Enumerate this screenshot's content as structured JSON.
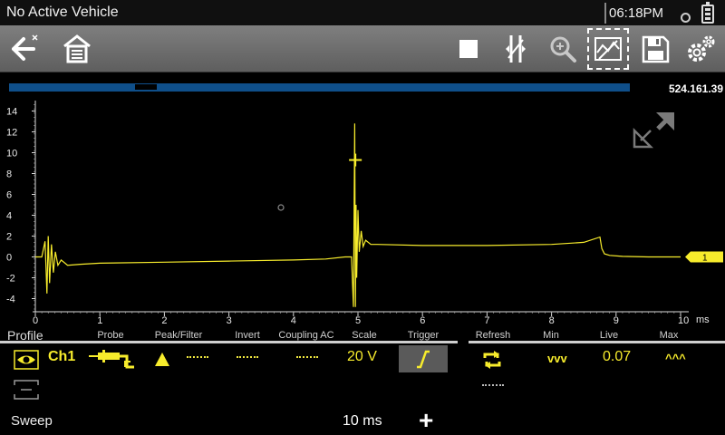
{
  "status": {
    "title": "No Active Vehicle",
    "clock": "06:18PM"
  },
  "toolbar": {
    "buttons": [
      "back-icon",
      "home-icon",
      "stop-icon",
      "cursor-icon",
      "zoom-icon",
      "capture-icon",
      "save-icon",
      "settings-icon"
    ]
  },
  "playback": {
    "position_readout": "524.161.39",
    "thumb_position_fraction": 0.22
  },
  "chart_data": {
    "type": "line",
    "xlabel": "ms",
    "ylabel": "",
    "xlim": [
      0,
      10
    ],
    "ylim": [
      -5,
      15
    ],
    "x_ticks": [
      "0",
      "1",
      "2",
      "3",
      "4",
      "5",
      "6",
      "7",
      "8",
      "9",
      "10"
    ],
    "y_ticks": [
      "14",
      "12",
      "10",
      "8",
      "6",
      "4",
      "2",
      "0",
      "-2",
      "-4"
    ],
    "series": [
      {
        "name": "Ch1",
        "color": "#f7ec2c",
        "x": [
          0,
          0.1,
          0.15,
          0.18,
          0.2,
          0.22,
          0.25,
          0.28,
          0.31,
          0.35,
          0.4,
          0.5,
          0.7,
          1,
          2,
          3,
          4,
          4.5,
          4.8,
          4.9,
          4.93,
          4.95,
          4.96,
          4.97,
          4.98,
          5,
          5.02,
          5.05,
          5.08,
          5.12,
          5.2,
          5.3,
          6,
          7,
          8,
          8.5,
          8.75,
          8.78,
          8.82,
          8.9,
          9.1,
          9.5,
          10
        ],
        "y": [
          0,
          0,
          1.5,
          -3.5,
          2,
          -2.5,
          1.2,
          -1.5,
          0.5,
          -0.8,
          -0.3,
          -0.8,
          -0.7,
          -0.6,
          -0.5,
          -0.4,
          -0.3,
          -0.2,
          0,
          0,
          -4.8,
          12.8,
          -4.8,
          5,
          -2,
          4.5,
          0.5,
          2.5,
          1,
          1.6,
          1.2,
          1.2,
          1.1,
          1.1,
          1.2,
          1.4,
          1.9,
          0.8,
          0.3,
          0.15,
          0.05,
          0,
          0
        ]
      }
    ],
    "cursor": {
      "x": 4.96,
      "y": 9.3
    },
    "channel_marker": "1"
  },
  "profile": {
    "label": "Profile",
    "columns": [
      "Probe",
      "Peak/Filter",
      "Invert",
      "Coupling AC",
      "Scale",
      "Trigger",
      "Refresh",
      "Min",
      "Live",
      "Max"
    ],
    "channel": {
      "name": "Ch1",
      "scale": "20 V",
      "min": "vvv",
      "live": "0.07",
      "max": "^^^"
    }
  },
  "sweep": {
    "label": "Sweep",
    "value": "10 ms",
    "plus": "+"
  }
}
